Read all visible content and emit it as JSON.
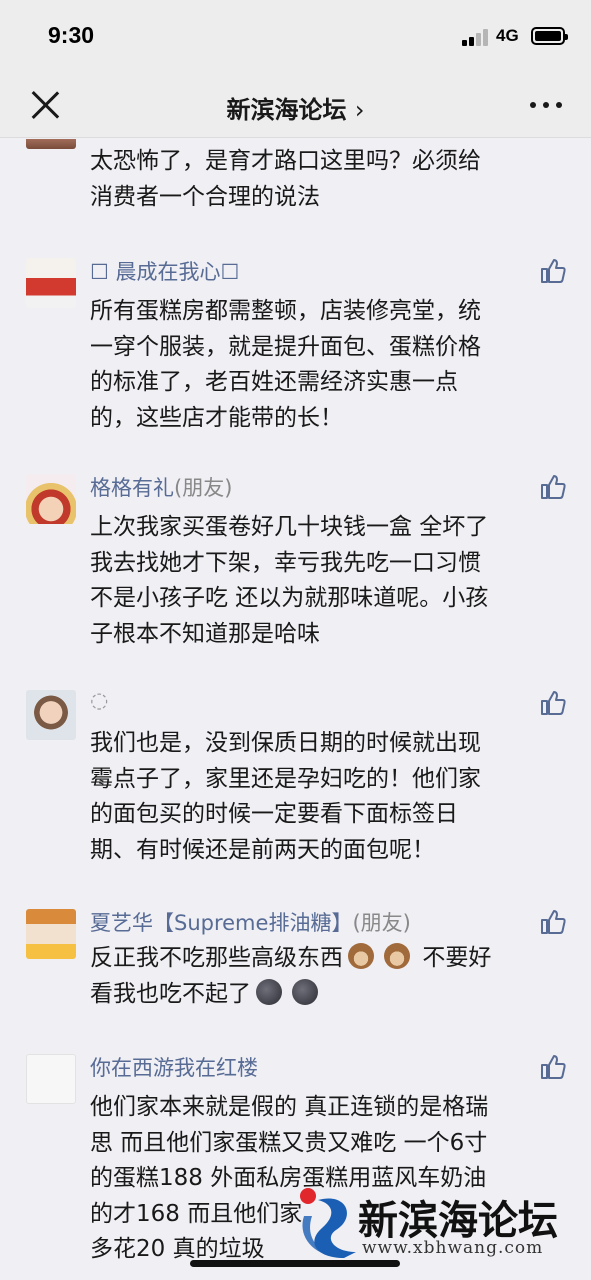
{
  "status_bar": {
    "time": "9:30",
    "network": "4G"
  },
  "nav": {
    "title": "新滨海论坛",
    "chevron": "›"
  },
  "comments": [
    {
      "author": "",
      "author_note": "",
      "lines": [
        "太恐怖了，是育才路口这里吗？必须给",
        "消费者一个合理的说法"
      ]
    },
    {
      "author": "☐ 晨成在我心☐",
      "author_note": "",
      "lines": [
        "所有蛋糕房都需整顿，店装修亮堂，统",
        "一穿个服装，就是提升面包、蛋糕价格",
        "的标准了，老百姓还需经济实惠一点",
        "的，这些店才能带的长！"
      ]
    },
    {
      "author": "格格有礼",
      "author_note": "(朋友)",
      "lines": [
        "上次我家买蛋卷好几十块钱一盒 全坏了",
        "我去找她才下架，幸亏我先吃一口习惯",
        "不是小孩子吃 还以为就那味道呢。小孩",
        "子根本不知道那是哈味"
      ]
    },
    {
      "author": "◌",
      "author_note": "",
      "lines": [
        "我们也是，没到保质日期的时候就出现",
        "霉点子了，家里还是孕妇吃的！他们家",
        "的面包买的时候一定要看下面标签日",
        "期、有时候还是前两天的面包呢！"
      ]
    },
    {
      "author": "夏艺华【Supreme排油糖】",
      "author_note": "(朋友)",
      "lines_a": "反正我不吃那些高级东西",
      "lines_b": "不要好",
      "lines_c": "看我也吃不起了"
    },
    {
      "author": "你在西游我在红楼",
      "author_note": "",
      "lines": [
        "他们家本来就是假的 真正连锁的是格瑞",
        "思 而且他们家蛋糕又贵又难吃 一个6寸",
        "的蛋糕188 外面私房蛋糕用蓝风车奶油",
        "的才168 而且他们家",
        "多花20 真的垃圾"
      ]
    }
  ],
  "watermark": {
    "text": "新滨海论坛",
    "url": "www.xbhwang.com"
  },
  "colors": {
    "link": "#576b95",
    "background": "#efeff4",
    "nav_background": "#ededed"
  }
}
